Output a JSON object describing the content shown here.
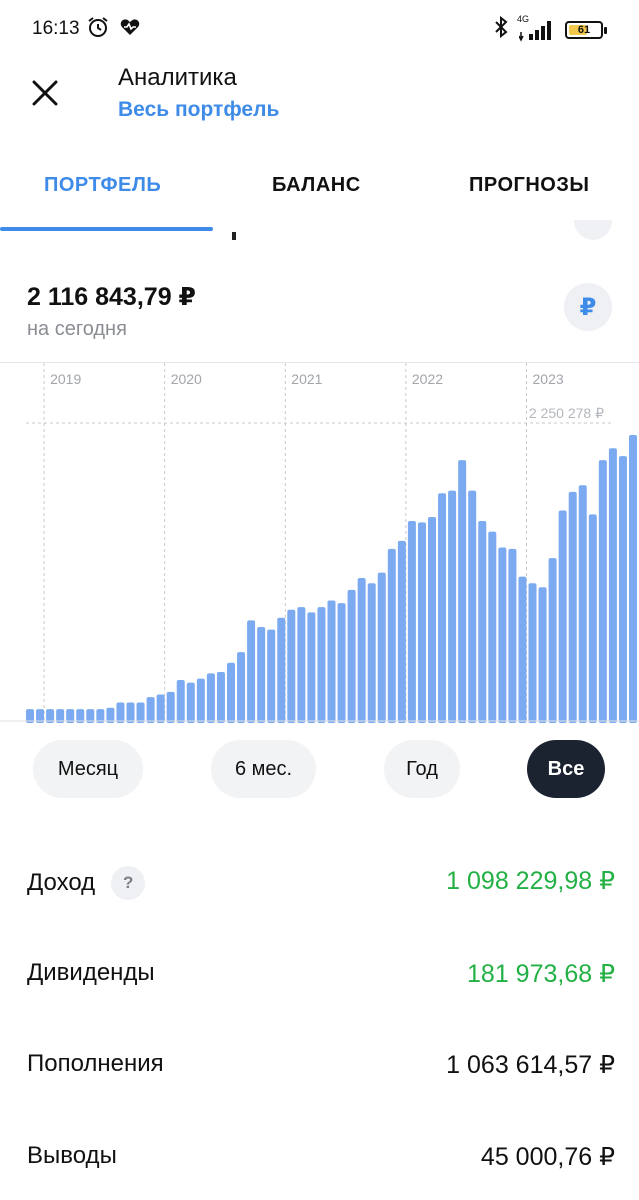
{
  "status_bar": {
    "time": "16:13",
    "network": "4G",
    "battery": "61",
    "battery_level": 0.61,
    "icons": [
      "alarm-icon",
      "heart-wave-icon",
      "bluetooth-icon",
      "signal-icon",
      "battery-icon"
    ]
  },
  "header": {
    "title": "Аналитика",
    "subtitle": "Весь портфель",
    "close_icon": "close-icon"
  },
  "tabs": [
    {
      "label": "ПОРТФЕЛЬ",
      "active": true
    },
    {
      "label": "БАЛАНС",
      "active": false
    },
    {
      "label": "ПРОГНОЗЫ",
      "active": false
    }
  ],
  "summary": {
    "balance": "2 116 843,79 ₽",
    "balance_caption": "на сегодня",
    "currency_symbol": "₽"
  },
  "chart_data": {
    "type": "bar",
    "max_label": "2 250 278 ₽",
    "year_labels": [
      {
        "label": "2019",
        "index": 2
      },
      {
        "label": "2020",
        "index": 14
      },
      {
        "label": "2021",
        "index": 26
      },
      {
        "label": "2022",
        "index": 38
      },
      {
        "label": "2023",
        "index": 50
      }
    ],
    "values": [
      90000,
      90000,
      90000,
      90000,
      90000,
      90000,
      90000,
      90000,
      100000,
      140000,
      140000,
      140000,
      180000,
      200000,
      220000,
      310000,
      290000,
      320000,
      360000,
      370000,
      440000,
      520000,
      760000,
      710000,
      690000,
      780000,
      840000,
      860000,
      820000,
      860000,
      910000,
      890000,
      990000,
      1080000,
      1040000,
      1120000,
      1300000,
      1360000,
      1510000,
      1500000,
      1540000,
      1720000,
      1740000,
      1970000,
      1740000,
      1510000,
      1430000,
      1310000,
      1300000,
      1090000,
      1040000,
      1010000,
      1230000,
      1590000,
      1730000,
      1780000,
      1560000,
      1970000,
      2060000,
      2000000,
      2160000,
      2250278,
      2100000
    ],
    "ylim": [
      0,
      2250278
    ],
    "bar_color": "#7baaf0",
    "grid": "vertical-dashed"
  },
  "periods": [
    {
      "label": "Месяц",
      "active": false
    },
    {
      "label": "6 мес.",
      "active": false
    },
    {
      "label": "Год",
      "active": false
    },
    {
      "label": "Все",
      "active": true
    }
  ],
  "stats": [
    {
      "label": "Доход",
      "value": "1 098 229,98 ₽",
      "color": "green",
      "help": "?"
    },
    {
      "label": "Дивиденды",
      "value": "181 973,68 ₽",
      "color": "green"
    },
    {
      "label": "Пополнения",
      "value": "1 063 614,57 ₽",
      "color": "default"
    },
    {
      "label": "Выводы",
      "value": "45 000,76 ₽",
      "color": "default"
    }
  ],
  "colors": {
    "accent": "#3f8be8",
    "positive": "#23b045",
    "active_pill": "#1b2230"
  }
}
